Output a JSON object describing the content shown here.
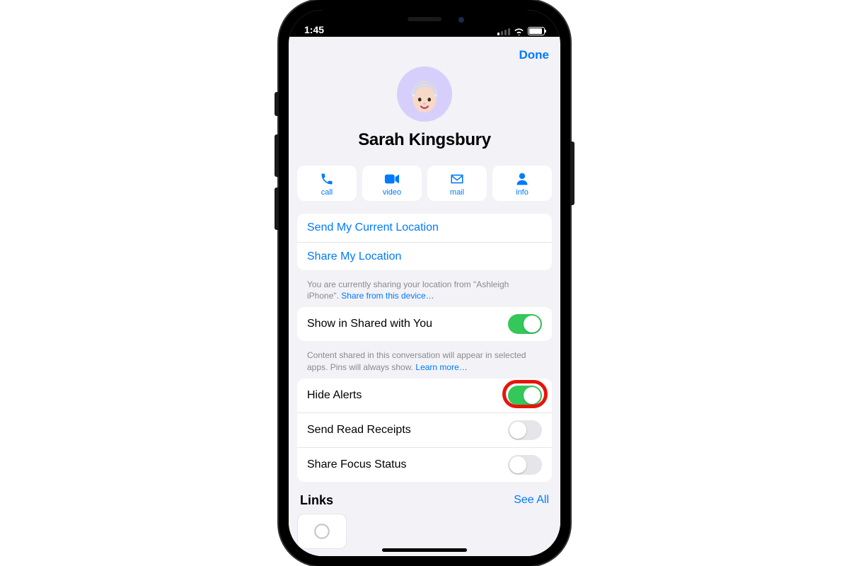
{
  "status": {
    "time": "1:45"
  },
  "sheet": {
    "done": "Done",
    "contact_name": "Sarah Kingsbury",
    "actions": {
      "call": "call",
      "video": "video",
      "mail": "mail",
      "info": "info"
    },
    "location_group": {
      "send_current": "Send My Current Location",
      "share": "Share My Location"
    },
    "location_footnote_pre": "You are currently sharing your location from \"Ashleigh iPhone\". ",
    "location_footnote_link": "Share from this device…",
    "shared_with_you": {
      "label": "Show in Shared with You",
      "on": true
    },
    "shared_footnote_pre": "Content shared in this conversation will appear in selected apps. Pins will always show. ",
    "shared_footnote_link": "Learn more…",
    "alerts_group": {
      "hide_alerts": {
        "label": "Hide Alerts",
        "on": true,
        "highlighted": true
      },
      "read_receipts": {
        "label": "Send Read Receipts",
        "on": false
      },
      "focus_status": {
        "label": "Share Focus Status",
        "on": false
      }
    },
    "links": {
      "title": "Links",
      "see_all": "See All"
    }
  }
}
